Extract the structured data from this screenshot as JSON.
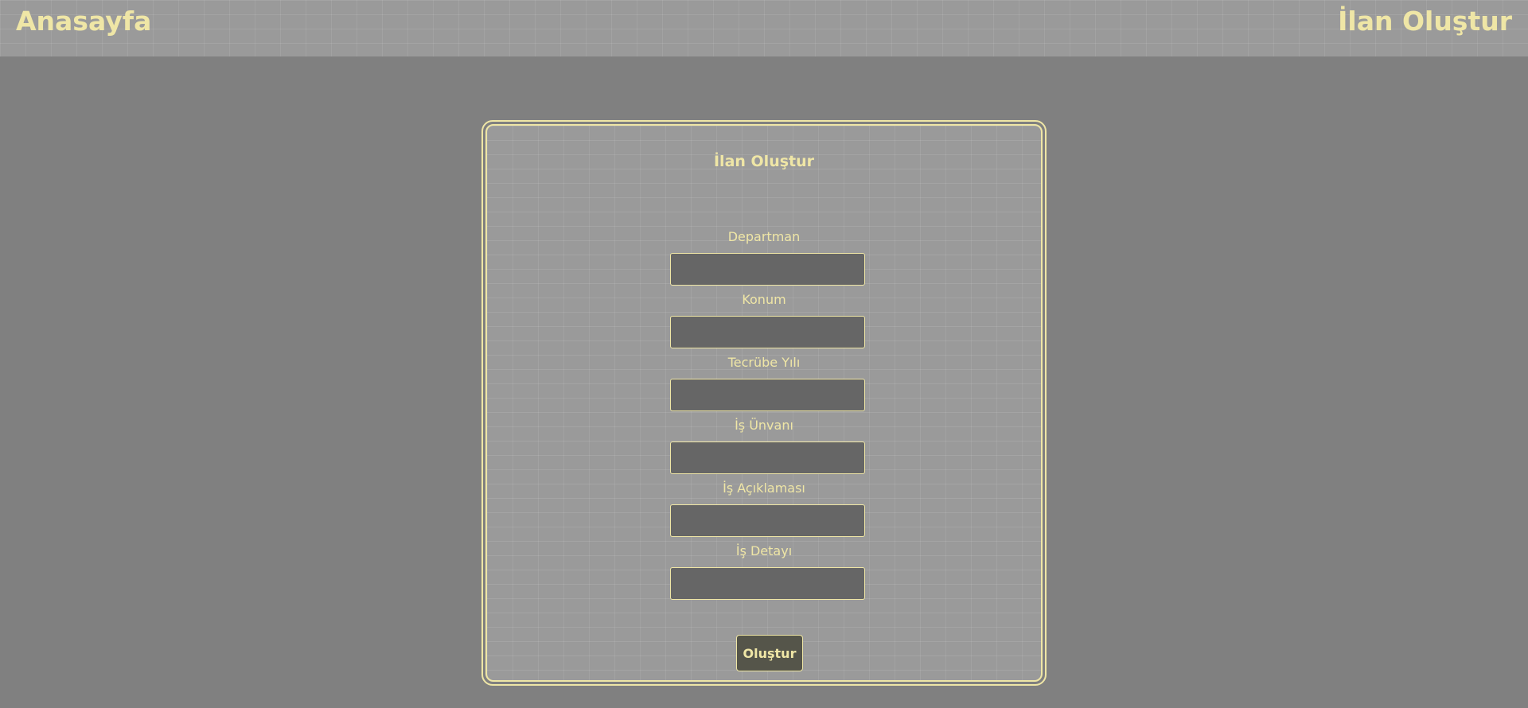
{
  "nav": {
    "home_label": "Anasayfa",
    "create_label": "İlan Oluştur"
  },
  "form": {
    "title": "İlan Oluştur",
    "fields": [
      {
        "label": "Departman",
        "value": ""
      },
      {
        "label": "Konum",
        "value": ""
      },
      {
        "label": "Tecrübe Yılı",
        "value": ""
      },
      {
        "label": "İş Ünvanı",
        "value": ""
      },
      {
        "label": "İş Açıklaması",
        "value": ""
      },
      {
        "label": "İş Detayı",
        "value": ""
      }
    ],
    "submit_label": "Oluştur"
  },
  "colors": {
    "accent": "#efe6a6",
    "background": "#808080",
    "panel": "#9a9a9a",
    "input_bg": "#666666"
  }
}
